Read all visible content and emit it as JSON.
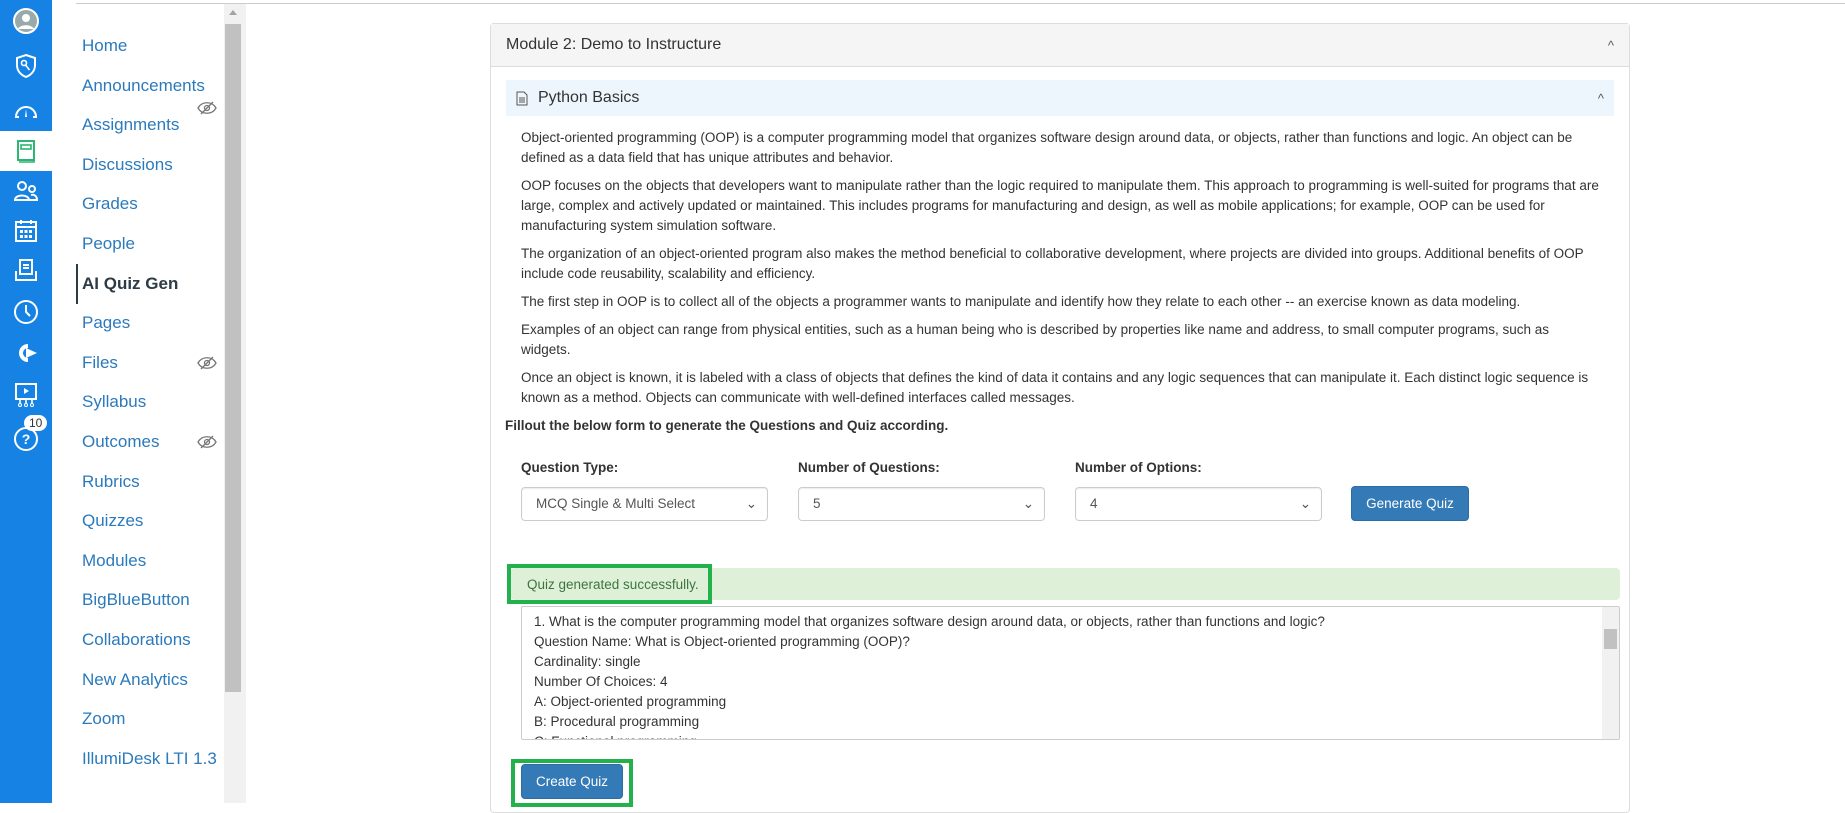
{
  "global_nav": {
    "items": [
      {
        "icon": "avatar-icon"
      },
      {
        "icon": "admin-shield-icon"
      },
      {
        "icon": "dashboard-icon"
      },
      {
        "icon": "courses-book-icon",
        "active": true
      },
      {
        "icon": "groups-icon"
      },
      {
        "icon": "calendar-icon"
      },
      {
        "icon": "inbox-icon"
      },
      {
        "icon": "history-clock-icon"
      },
      {
        "icon": "commons-arrow-icon"
      },
      {
        "icon": "studio-icon"
      },
      {
        "icon": "help-icon",
        "badge": "10"
      }
    ]
  },
  "course_nav": {
    "items": [
      {
        "label": "Home"
      },
      {
        "label": "Announcements"
      },
      {
        "label": "Assignments",
        "hidden": true
      },
      {
        "label": "Discussions"
      },
      {
        "label": "Grades"
      },
      {
        "label": "People"
      },
      {
        "label": "AI Quiz Gen",
        "current": true
      },
      {
        "label": "Pages"
      },
      {
        "label": "Files",
        "hidden": true
      },
      {
        "label": "Syllabus"
      },
      {
        "label": "Outcomes",
        "hidden": true
      },
      {
        "label": "Rubrics"
      },
      {
        "label": "Quizzes"
      },
      {
        "label": "Modules"
      },
      {
        "label": "BigBlueButton"
      },
      {
        "label": "Collaborations"
      },
      {
        "label": "New Analytics"
      },
      {
        "label": "Zoom"
      },
      {
        "label": "IllumiDesk LTI 1.3"
      }
    ]
  },
  "module": {
    "title": "Module 2: Demo to Instructure",
    "item_title": "Python Basics",
    "paragraphs": [
      "Object-oriented programming (OOP) is a computer programming model that organizes software design around data, or objects, rather than functions and logic. An object can be defined as a data field that has unique attributes and behavior.",
      "OOP focuses on the objects that developers want to manipulate rather than the logic required to manipulate them. This approach to programming is well-suited for programs that are large, complex and actively updated or maintained. This includes programs for manufacturing and design, as well as mobile applications; for example, OOP can be used for manufacturing system simulation software.",
      "The organization of an object-oriented program also makes the method beneficial to collaborative development, where projects are divided into groups. Additional benefits of OOP include code reusability, scalability and efficiency.",
      "The first step in OOP is to collect all of the objects a programmer wants to manipulate and identify how they relate to each other -- an exercise known as data modeling.",
      "Examples of an object can range from physical entities, such as a human being who is described by properties like name and address, to small computer programs, such as widgets.",
      "Once an object is known, it is labeled with a class of objects that defines the kind of data it contains and any logic sequences that can manipulate it. Each distinct logic sequence is known as a method. Objects can communicate with well-defined interfaces called messages."
    ]
  },
  "form": {
    "instructions": "Fillout the below form to generate the Questions and Quiz according.",
    "question_type": {
      "label": "Question Type:",
      "value": "MCQ Single & Multi Select"
    },
    "num_questions": {
      "label": "Number of Questions:",
      "value": "5"
    },
    "num_options": {
      "label": "Number of Options:",
      "value": "4"
    },
    "generate_label": "Generate Quiz"
  },
  "result": {
    "status": "Quiz generated successfully.",
    "lines": [
      "1. What is the computer programming model that organizes software design around data, or objects, rather than functions and logic?",
      "Question Name: What is Object-oriented programming (OOP)?",
      "Cardinality: single",
      "Number Of Choices: 4",
      "A: Object-oriented programming",
      "B: Procedural programming",
      "C: Functional programming"
    ],
    "create_label": "Create Quiz"
  },
  "colors": {
    "rail": "#1582e4",
    "link": "#2b7abc",
    "primary_button": "#337ab7",
    "success_bg": "#dff0d8",
    "highlight": "#22b14c"
  }
}
